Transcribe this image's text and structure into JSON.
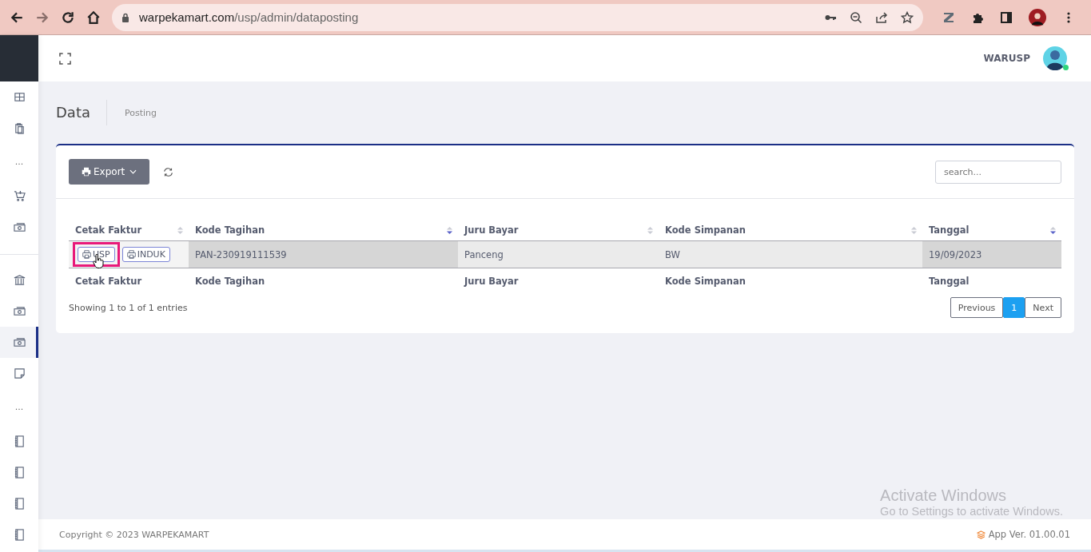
{
  "browser": {
    "url_host": "warpekamart.com",
    "url_path": "/usp/admin/dataposting"
  },
  "sidebar": {
    "items": [
      {
        "kind": "grid",
        "selected": false
      },
      {
        "kind": "clipboard",
        "selected": false
      },
      {
        "kind": "dots",
        "text": "..."
      },
      {
        "kind": "cart",
        "selected": false
      },
      {
        "kind": "money",
        "selected": false
      },
      {
        "kind": "divider"
      },
      {
        "kind": "bank",
        "selected": false
      },
      {
        "kind": "money",
        "selected": false
      },
      {
        "kind": "money",
        "selected": true
      },
      {
        "kind": "note",
        "selected": false
      },
      {
        "kind": "dots",
        "text": "..."
      },
      {
        "kind": "book",
        "selected": false
      },
      {
        "kind": "book",
        "selected": false
      },
      {
        "kind": "book",
        "selected": false
      },
      {
        "kind": "book",
        "selected": false
      }
    ]
  },
  "header": {
    "user": "WARUSP",
    "online": true
  },
  "page": {
    "title": "Data",
    "breadcrumb": "Posting"
  },
  "toolbar": {
    "export_label": "Export",
    "search_placeholder": "search..."
  },
  "table": {
    "columns": [
      {
        "label": "Cetak Faktur",
        "sorted": false
      },
      {
        "label": "Kode Tagihan",
        "sorted": true
      },
      {
        "label": "Juru Bayar",
        "sorted": false
      },
      {
        "label": "Kode Simpanan",
        "sorted": false
      },
      {
        "label": "Tanggal",
        "sorted": true
      }
    ],
    "rows": [
      {
        "cells": [
          {
            "buttons": [
              {
                "label": "USP",
                "highlighted": true
              },
              {
                "label": "INDUK",
                "highlighted": false
              }
            ]
          },
          "PAN-230919111539",
          "Panceng",
          "BW",
          "19/09/2023"
        ]
      }
    ],
    "footer": [
      "Cetak Faktur",
      "Kode Tagihan",
      "Juru Bayar",
      "Kode Simpanan",
      "Tanggal"
    ],
    "info": "Showing 1 to 1 of 1 entries",
    "pagination": {
      "previous": "Previous",
      "pages": [
        {
          "label": "1",
          "selected": true
        }
      ],
      "next": "Next"
    }
  },
  "watermark_note": {
    "title": "Activate Windows",
    "subtitle": "Go to Settings to activate Windows."
  },
  "footer": {
    "copyright": "Copyright © 2023 WARPEKAMART",
    "version": "App Ver. 01.00.01"
  }
}
